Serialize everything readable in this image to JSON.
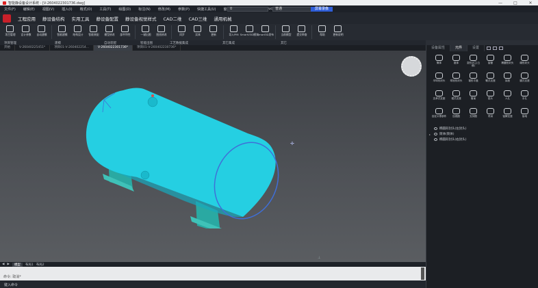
{
  "window": {
    "title": "智能静设备设计系统 - [V-2604022301736.dwg]",
    "controls": [
      "—",
      "□",
      "✕"
    ]
  },
  "menu": {
    "items": [
      "文件(F)",
      "编辑(E)",
      "视图(V)",
      "插入(I)",
      "格式(O)",
      "工具(T)",
      "绘图(D)",
      "标注(N)",
      "修改(M)",
      "参数(P)",
      "快捷工具(U)",
      "窗口(W)",
      "帮助(H)",
      "Structure"
    ],
    "layer_combo": "0",
    "text_combo": "普通",
    "record_button": "屏幕录像"
  },
  "ribbon_tabs": [
    "工程应用",
    "静设备结构",
    "实用工具",
    "静设备配置",
    "静设备视觉样式",
    "CAD二维",
    "CAD三维",
    "通用机械"
  ],
  "ribbon_tools": [
    {
      "label": "项目管理",
      "icon": "project-icon"
    },
    {
      "label": "设计参数",
      "icon": "params-icon"
    },
    {
      "label": "自动建模",
      "icon": "auto-model-icon"
    },
    {
      "label": "智能建模",
      "icon": "smart-model-icon"
    },
    {
      "label": "结构设计",
      "icon": "structure-icon"
    },
    {
      "label": "智能装配",
      "icon": "assembly-icon"
    },
    {
      "label": "模型修改",
      "icon": "model-edit-icon"
    },
    {
      "label": "部件特性",
      "icon": "part-prop-icon"
    },
    {
      "label": "一键出图",
      "icon": "drawing-icon"
    },
    {
      "label": "图纸修改",
      "icon": "sheet-edit-icon"
    },
    {
      "label": "同步",
      "icon": "sync-icon"
    },
    {
      "label": "实体",
      "icon": "solid-icon"
    },
    {
      "label": "更新",
      "icon": "update-icon"
    },
    {
      "label": "导入PMI",
      "icon": "import-pmi-icon"
    },
    {
      "label": "SmartV3D模块",
      "icon": "smartv3d-icon"
    },
    {
      "label": "Smart3D发布",
      "icon": "smart3d-publish-icon"
    },
    {
      "label": "当前模型",
      "icon": "current-model-icon"
    },
    {
      "label": "提交审查",
      "icon": "submit-review-icon"
    },
    {
      "label": "帮助",
      "icon": "help-icon"
    },
    {
      "label": "更新说明",
      "icon": "update-notes-icon"
    }
  ],
  "ribbon_groups": [
    "项目管理",
    "建模",
    "自动装配",
    "智能出图",
    "工艺数据集成",
    "其它集成",
    "其它"
  ],
  "doc_tabs": [
    "开始",
    "V-26040225451*",
    "项目01-V-260402254...",
    "V-2604022301736*",
    "项目01-V-260402230736*"
  ],
  "active_doc_tab": 3,
  "layout_tabs": [
    "模型",
    "布局1",
    "布局2"
  ],
  "command": {
    "history": "命令: 取消*",
    "close_label": "关闭",
    "input_prompt": "键入命令"
  },
  "panel": {
    "tabs": [
      "设备属性",
      "元件",
      "设置"
    ],
    "active_tab": 1,
    "components": [
      {
        "label": "筒体",
        "icon": "cylinder-shell-icon"
      },
      {
        "label": "锥体",
        "icon": "cone-icon"
      },
      {
        "label": "变形法兰(凸缘)",
        "icon": "flange-icon"
      },
      {
        "label": "接管",
        "icon": "nozzle-icon"
      },
      {
        "label": "椭圆形封头",
        "icon": "elliptical-head-icon"
      },
      {
        "label": "碟形封头",
        "icon": "dished-head-icon"
      },
      {
        "label": "半球形封头",
        "icon": "hemispherical-head-icon"
      },
      {
        "label": "球冠形封头",
        "icon": "spherical-cap-icon"
      },
      {
        "label": "锥形平盖",
        "icon": "flat-cover-icon"
      },
      {
        "label": "鞍式支座",
        "icon": "saddle-support-icon"
      },
      {
        "label": "耳座",
        "icon": "lug-icon"
      },
      {
        "label": "腿式支座",
        "icon": "leg-support-icon"
      },
      {
        "label": "支承式支座",
        "icon": "bearing-support-icon"
      },
      {
        "label": "裙式支座",
        "icon": "skirt-icon"
      },
      {
        "label": "管束",
        "icon": "tube-bundle-icon"
      },
      {
        "label": "垫片",
        "icon": "gasket-icon"
      },
      {
        "label": "人孔",
        "icon": "manhole-icon"
      },
      {
        "label": "手孔",
        "icon": "handhole-icon"
      },
      {
        "label": "自定义零部件",
        "icon": "custom-part-icon"
      },
      {
        "label": "加强圈",
        "icon": "stiffener-ring-icon"
      },
      {
        "label": "支持圈",
        "icon": "support-ring-icon"
      },
      {
        "label": "吊耳",
        "icon": "lifting-lug-icon"
      },
      {
        "label": "铭牌支座",
        "icon": "nameplate-icon"
      },
      {
        "label": "接地",
        "icon": "grounding-icon"
      }
    ],
    "tree": [
      {
        "label": "椭圆形封头(左封头)",
        "expand": false
      },
      {
        "label": "筒体(筒体)",
        "expand": true
      },
      {
        "label": "椭圆形封头(右封头)",
        "expand": false
      }
    ]
  },
  "colors": {
    "vessel": "#22cde0",
    "vessel_dark": "#0f9fb3",
    "support": "#34b7b0",
    "selection": "#3f6fd8"
  }
}
